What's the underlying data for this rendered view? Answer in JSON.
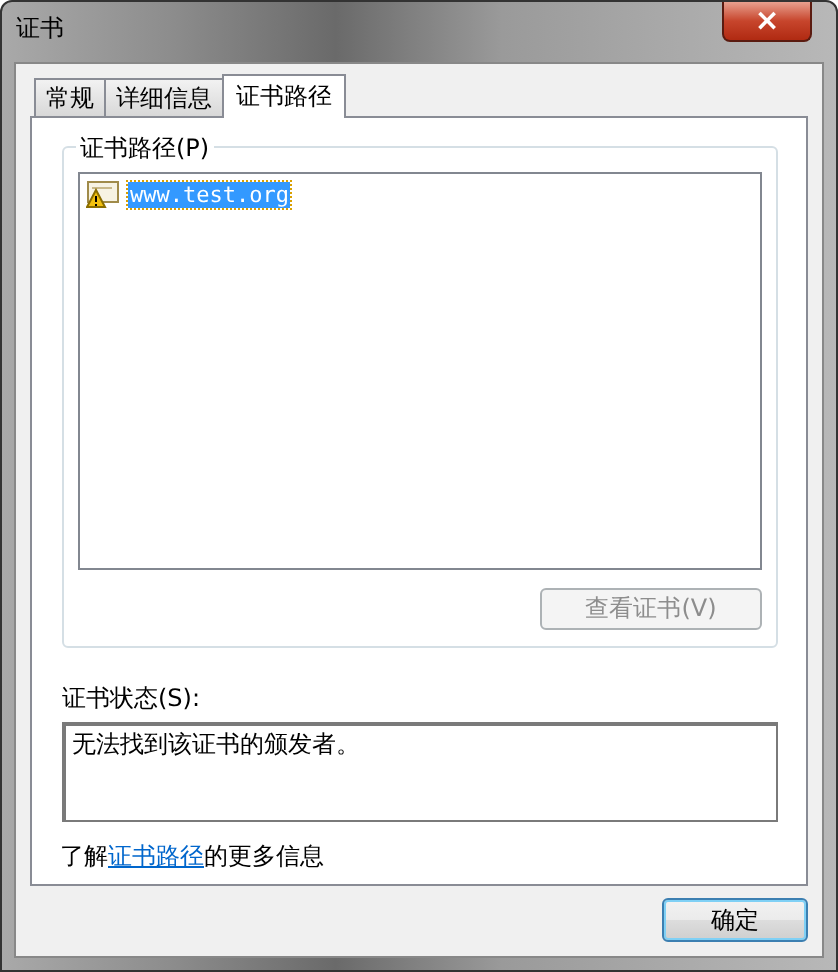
{
  "window": {
    "title": "证书",
    "close_label": "×"
  },
  "tabs": [
    {
      "label": "常规",
      "selected": false
    },
    {
      "label": "详细信息",
      "selected": false
    },
    {
      "label": "证书路径",
      "selected": true
    }
  ],
  "path_group": {
    "title": "证书路径(P)",
    "items": [
      {
        "label": "www.test.org",
        "selected": true,
        "kind": "warning"
      }
    ],
    "view_button": {
      "label": "查看证书(V)",
      "disabled": true
    }
  },
  "status": {
    "label": "证书状态(S):",
    "value": "无法找到该证书的颁发者。"
  },
  "info": {
    "before": "了解",
    "link": "证书路径",
    "after": "的更多信息"
  },
  "buttons": [
    {
      "label": "确定",
      "default": true
    }
  ]
}
